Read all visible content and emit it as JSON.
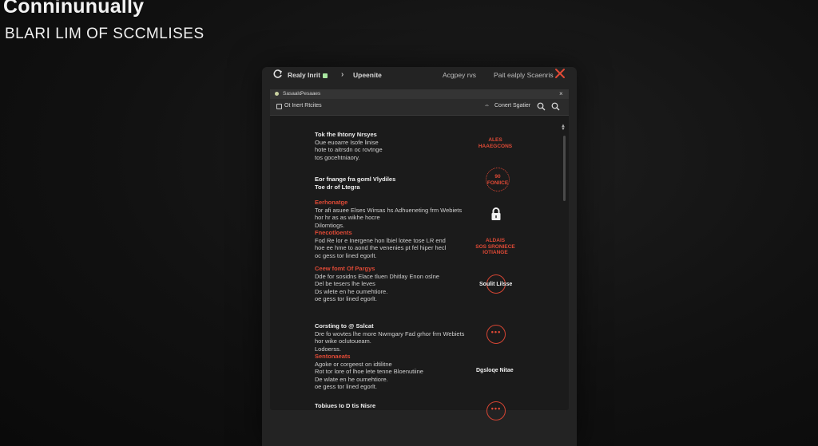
{
  "page": {
    "title": "Conninunually",
    "subtitle": "BLARI LIM OF SCCMLISES"
  },
  "window": {
    "toolbar": {
      "ready_label": "Realy Inrit",
      "update_label": "Upeenite",
      "right_label_1": "Acgpey rvs",
      "right_label_2": "Pait ealply Scaenris"
    },
    "tabs": [
      "Sasaalo",
      "Pesaaes"
    ],
    "address": {
      "text": "Ot Inert Rtcites",
      "right_text": "Conert Sgatier"
    }
  },
  "content": {
    "sections": [
      {
        "lines": [
          {
            "style": "h",
            "text": "Tok fhe Ihtony Nrsyes"
          },
          {
            "style": "t",
            "text": "Oue euoarre Isofe linise"
          },
          {
            "style": "t",
            "text": "hote to aitrsdn oc rovtnge"
          },
          {
            "style": "t",
            "text": "tos gocehtniaory."
          }
        ]
      },
      {
        "lines": [
          {
            "style": "h",
            "text": "Eor fnange fra goml Vlydiles"
          },
          {
            "style": "h",
            "text": "Toe dr of Ltegra"
          }
        ]
      },
      {
        "lines": [
          {
            "style": "r",
            "text": "Eerhonatge"
          },
          {
            "style": "t",
            "text": "Tor afi asuee Elses Wirsas hs Adhueneting frm Webiets"
          },
          {
            "style": "t",
            "text": "hor hr as as wikhe hocre"
          },
          {
            "style": "t",
            "text": "Dilomtiogs."
          },
          {
            "style": "r",
            "text": "Fnecotloents"
          },
          {
            "style": "t",
            "text": "Fod Re lor e Inergene hon lbiel lotee tose LR end"
          },
          {
            "style": "t",
            "text": "hoe ee hme to aond Ihe venenies pt fel hiper hecl"
          },
          {
            "style": "t",
            "text": "oc gess tor lined egorlt."
          }
        ]
      },
      {
        "lines": [
          {
            "style": "r",
            "text": "Ceew fomt Of Pargys"
          },
          {
            "style": "t",
            "text": "Dde for sosidns Elace tluen Dhitlay Enon oslne"
          },
          {
            "style": "t",
            "text": "Del be tesers lhe leves"
          },
          {
            "style": "t",
            "text": "Ds wlete en he oumehtiore."
          },
          {
            "style": "t",
            "text": "oe gess tor lined egorlt."
          }
        ]
      },
      {
        "lines": [
          {
            "style": "h",
            "text": "Corsting to @ Sslcat"
          },
          {
            "style": "t",
            "text": "Dre fo wovtes lhe more Nwmgary Fad grhor frm Webiets"
          },
          {
            "style": "t",
            "text": "hor wike oclutoueam."
          },
          {
            "style": "t",
            "text": "Lodoerss."
          },
          {
            "style": "r",
            "text": "Sentonaeats"
          },
          {
            "style": "t",
            "text": "Agoke or corgeest on idtilitne"
          },
          {
            "style": "t",
            "text": "Rot tor lore of lhoe lete tenne Bloenutiine"
          },
          {
            "style": "t",
            "text": "De wlate en he oumehtiore."
          },
          {
            "style": "t",
            "text": "oe gess tor lined egorlt."
          }
        ]
      },
      {
        "lines": [
          {
            "style": "h",
            "text": "Tobiues Io D tis Nisre"
          }
        ]
      }
    ],
    "widgets": {
      "badge1": [
        "ALES",
        "HAAEGCONS"
      ],
      "badge2": [
        "90",
        "FONIICE"
      ],
      "lock_icon": "lock-icon",
      "badge3": [
        "ALDAIS",
        "SOS SRONIECE",
        "IOTIANGE"
      ],
      "label1": "Soulit Lilsse",
      "label2": "Dgsloqe Nitae"
    }
  },
  "colors": {
    "accent": "#e04a36",
    "background": "#0e0e0e",
    "panel": "#1b1b1b"
  }
}
